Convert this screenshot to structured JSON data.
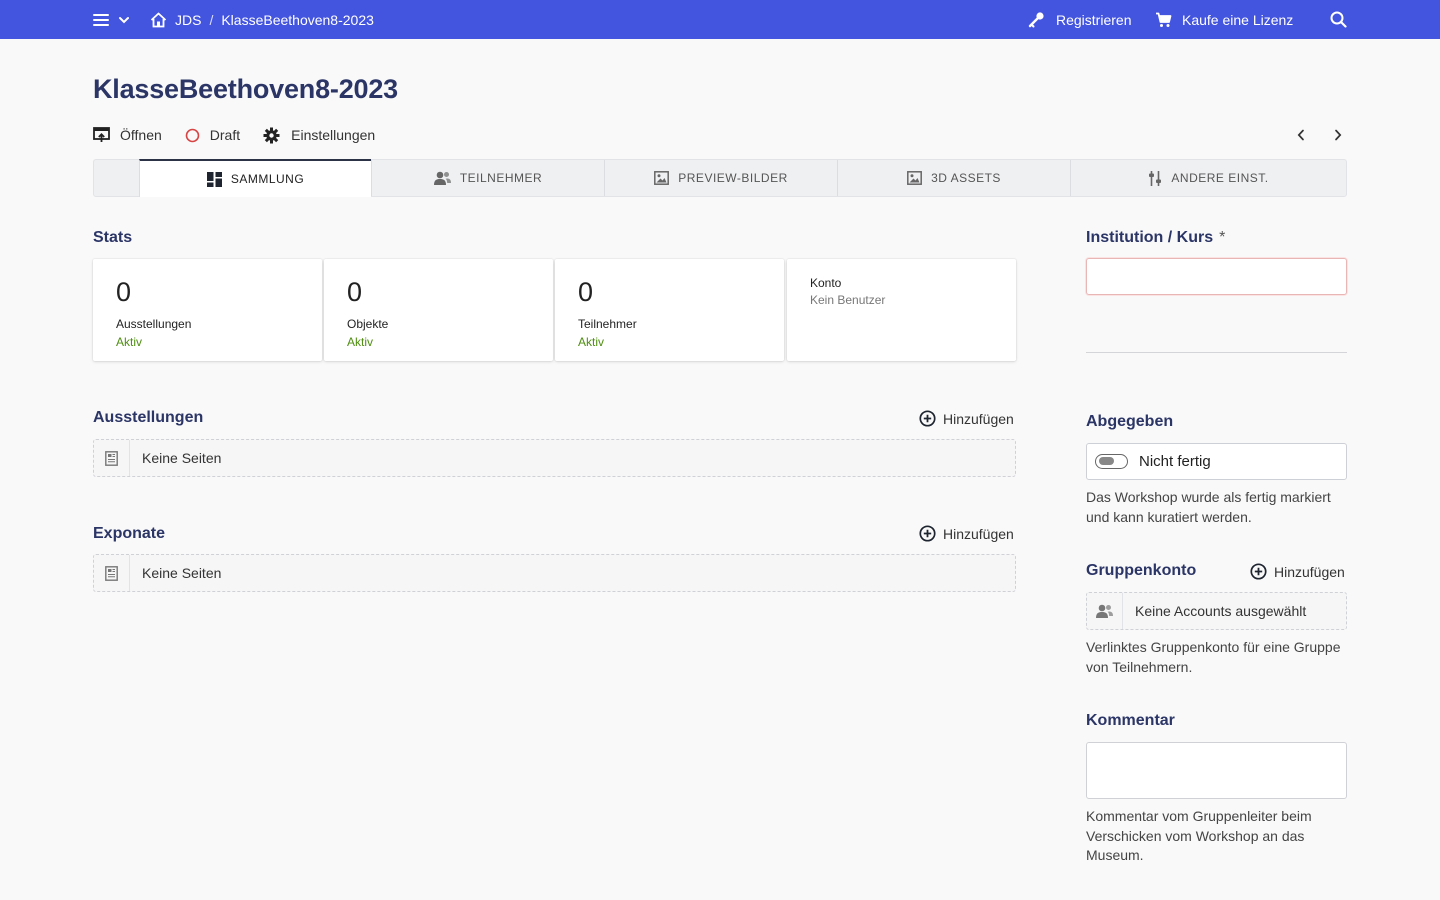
{
  "topbar": {
    "crumb_root": "JDS",
    "crumb_sep": "/",
    "crumb_current": "KlasseBeethoven8-2023",
    "register_label": "Registrieren",
    "license_label": "Kaufe eine Lizenz",
    "color": "#4354de"
  },
  "page": {
    "title": "KlasseBeethoven8-2023",
    "actions": {
      "open": "Öffnen",
      "draft": "Draft",
      "settings": "Einstellungen"
    }
  },
  "tabs": [
    {
      "label": "SAMMLUNG",
      "icon": "dashboard-icon",
      "active": true
    },
    {
      "label": "TEILNEHMER",
      "icon": "users-icon"
    },
    {
      "label": "PREVIEW-BILDER",
      "icon": "image-icon"
    },
    {
      "label": "3D ASSETS",
      "icon": "image-icon"
    },
    {
      "label": "ANDERE EINST.",
      "icon": "sliders-icon"
    }
  ],
  "stats": {
    "heading": "Stats",
    "cards": [
      {
        "value": "0",
        "label": "Ausstellungen",
        "status": "Aktiv"
      },
      {
        "value": "0",
        "label": "Objekte",
        "status": "Aktiv"
      },
      {
        "value": "0",
        "label": "Teilnehmer",
        "status": "Aktiv"
      }
    ],
    "account": {
      "label": "Konto",
      "value": "Kein Benutzer"
    }
  },
  "exhibitions": {
    "heading": "Ausstellungen",
    "add": "Hinzufügen",
    "empty": "Keine Seiten"
  },
  "exhibits": {
    "heading": "Exponate",
    "add": "Hinzufügen",
    "empty": "Keine Seiten"
  },
  "sidebar": {
    "institution": {
      "label": "Institution / Kurs",
      "required": "*",
      "value": ""
    },
    "submitted": {
      "heading": "Abgegeben",
      "toggle_label": "Nicht fertig",
      "checked": false,
      "help": "Das Workshop wurde als fertig markiert und kann kuratiert werden."
    },
    "group_account": {
      "heading": "Gruppenkonto",
      "add": "Hinzufügen",
      "empty": "Keine Accounts ausgewählt",
      "help": "Verlinktes Gruppenkonto für eine Gruppe von Teilnehmern."
    },
    "comment": {
      "heading": "Kommentar",
      "value": "",
      "help": "Kommentar vom Gruppenleiter beim Verschicken vom Workshop an das Museum."
    }
  }
}
